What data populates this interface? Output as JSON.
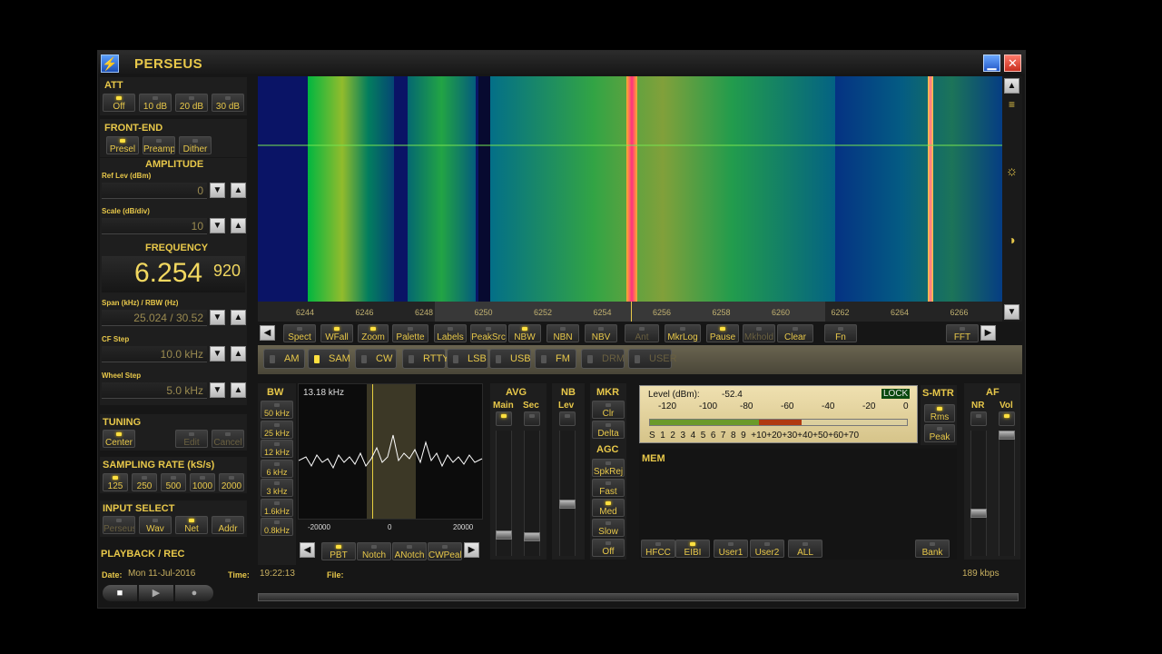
{
  "app": {
    "title": "PERSEUS"
  },
  "att": {
    "header": "ATT",
    "buttons": [
      {
        "label": "Off",
        "on": true
      },
      {
        "label": "10 dB",
        "on": false
      },
      {
        "label": "20 dB",
        "on": false
      },
      {
        "label": "30 dB",
        "on": false
      }
    ]
  },
  "frontend": {
    "header": "FRONT-END",
    "buttons": [
      {
        "label": "Presel",
        "on": true
      },
      {
        "label": "Preamp",
        "on": false
      },
      {
        "label": "Dither",
        "on": false
      }
    ]
  },
  "amplitude": {
    "header": "AMPLITUDE",
    "ref_label": "Ref Lev (dBm)",
    "ref_value": "0",
    "scale_label": "Scale (dB/div)",
    "scale_value": "10"
  },
  "frequency": {
    "header": "FREQUENCY",
    "main": "6.254",
    "sub": "920",
    "span_label": "Span (kHz) / RBW (Hz)",
    "span_value": "25.024 / 30.52",
    "cf_label": "CF Step",
    "cf_value": "10.0 kHz",
    "wheel_label": "Wheel Step",
    "wheel_value": "5.0 kHz"
  },
  "tuning": {
    "header": "TUNING",
    "buttons": [
      {
        "label": "Center",
        "on": true
      },
      {
        "label": "Edit",
        "on": false
      },
      {
        "label": "Cancel",
        "on": false
      }
    ]
  },
  "sampling": {
    "header": "SAMPLING RATE (kS/s)",
    "buttons": [
      {
        "label": "125",
        "on": true
      },
      {
        "label": "250",
        "on": false
      },
      {
        "label": "500",
        "on": false
      },
      {
        "label": "1000",
        "on": false
      },
      {
        "label": "2000",
        "on": false
      }
    ]
  },
  "input_select": {
    "header": "INPUT SELECT",
    "buttons": [
      {
        "label": "Perseus",
        "on": false
      },
      {
        "label": "Wav",
        "on": false
      },
      {
        "label": "Net",
        "on": true
      },
      {
        "label": "Addr",
        "on": false
      }
    ]
  },
  "playback": {
    "header": "PLAYBACK / REC"
  },
  "status": {
    "date_label": "Date:",
    "date_value": "Mon 11-Jul-2016",
    "time_label": "Time:",
    "time_value": "19:22:13",
    "file_label": "File:",
    "bitrate": "189 kbps"
  },
  "spectrum": {
    "ticks": [
      "6244",
      "6246",
      "6248",
      "6250",
      "6252",
      "6254",
      "6256",
      "6258",
      "6260",
      "6262",
      "6264",
      "6266"
    ]
  },
  "toolbar": {
    "buttons": [
      {
        "label": "Spect",
        "on": false
      },
      {
        "label": "WFall",
        "on": true
      },
      {
        "label": "Zoom",
        "on": true
      },
      {
        "label": "Palette",
        "on": false
      },
      {
        "label": "Labels",
        "on": false
      },
      {
        "label": "PeakSrc",
        "on": false
      },
      {
        "label": "NBW",
        "on": true
      },
      {
        "label": "NBN",
        "on": false
      },
      {
        "label": "NBV",
        "on": false
      },
      {
        "label": "Ant",
        "on": false
      },
      {
        "label": "MkrLog",
        "on": false
      },
      {
        "label": "Pause",
        "on": true
      },
      {
        "label": "Mkhold",
        "on": false
      },
      {
        "label": "Clear",
        "on": false
      },
      {
        "label": "Fn",
        "on": false
      },
      {
        "label": "FFT",
        "on": false
      }
    ]
  },
  "modes": [
    {
      "label": "AM",
      "on": false
    },
    {
      "label": "SAM",
      "on": true
    },
    {
      "label": "CW",
      "on": false
    },
    {
      "label": "RTTY",
      "on": false
    },
    {
      "label": "LSB",
      "on": false
    },
    {
      "label": "USB",
      "on": false
    },
    {
      "label": "FM",
      "on": false
    },
    {
      "label": "DRM",
      "on": false
    },
    {
      "label": "USER",
      "on": false
    }
  ],
  "bw": {
    "header": "BW",
    "value": "13.18 kHz",
    "buttons": [
      "50 kHz",
      "25 kHz",
      "12 kHz",
      "6 kHz",
      "3 kHz",
      "1.6kHz",
      "0.8kHz"
    ],
    "scale": [
      "-20000",
      "0",
      "20000"
    ]
  },
  "filter_buttons": [
    {
      "label": "PBT",
      "on": true
    },
    {
      "label": "Notch",
      "on": false
    },
    {
      "label": "ANotch",
      "on": false
    },
    {
      "label": "CWPeak",
      "on": false
    }
  ],
  "avg": {
    "header": "AVG",
    "main": "Main",
    "sec": "Sec"
  },
  "nb": {
    "header": "NB",
    "lev": "Lev"
  },
  "mkr": {
    "header": "MKR",
    "buttons": [
      {
        "label": "Clr",
        "on": false
      },
      {
        "label": "Delta",
        "on": false
      }
    ]
  },
  "agc": {
    "header": "AGC",
    "buttons": [
      {
        "label": "SpkRej",
        "on": false
      },
      {
        "label": "Fast",
        "on": false
      },
      {
        "label": "Med",
        "on": true
      },
      {
        "label": "Slow",
        "on": false
      },
      {
        "label": "Off",
        "on": false
      }
    ]
  },
  "smeter": {
    "level_label": "Level (dBm):",
    "level_value": "-52.4",
    "lock": "LOCK",
    "top_scale": [
      "-120",
      "-100",
      "-80",
      "-60",
      "-40",
      "-20",
      "0"
    ],
    "bottom_scale": "S  1  2  3  4  5  6  7  8  9  +10+20+30+40+50+60+70",
    "level_fraction": 0.59
  },
  "smtr": {
    "header": "S-MTR",
    "buttons": [
      {
        "label": "Rms",
        "on": true
      },
      {
        "label": "Peak",
        "on": false
      }
    ]
  },
  "af": {
    "header": "AF",
    "nr": "NR",
    "vol": "Vol"
  },
  "mem": {
    "header": "MEM",
    "buttons": [
      {
        "label": "HFCC",
        "on": false
      },
      {
        "label": "EIBI",
        "on": true
      },
      {
        "label": "User1",
        "on": false
      },
      {
        "label": "User2",
        "on": false
      },
      {
        "label": "ALL",
        "on": false
      },
      {
        "label": "Bank",
        "on": false
      }
    ]
  }
}
